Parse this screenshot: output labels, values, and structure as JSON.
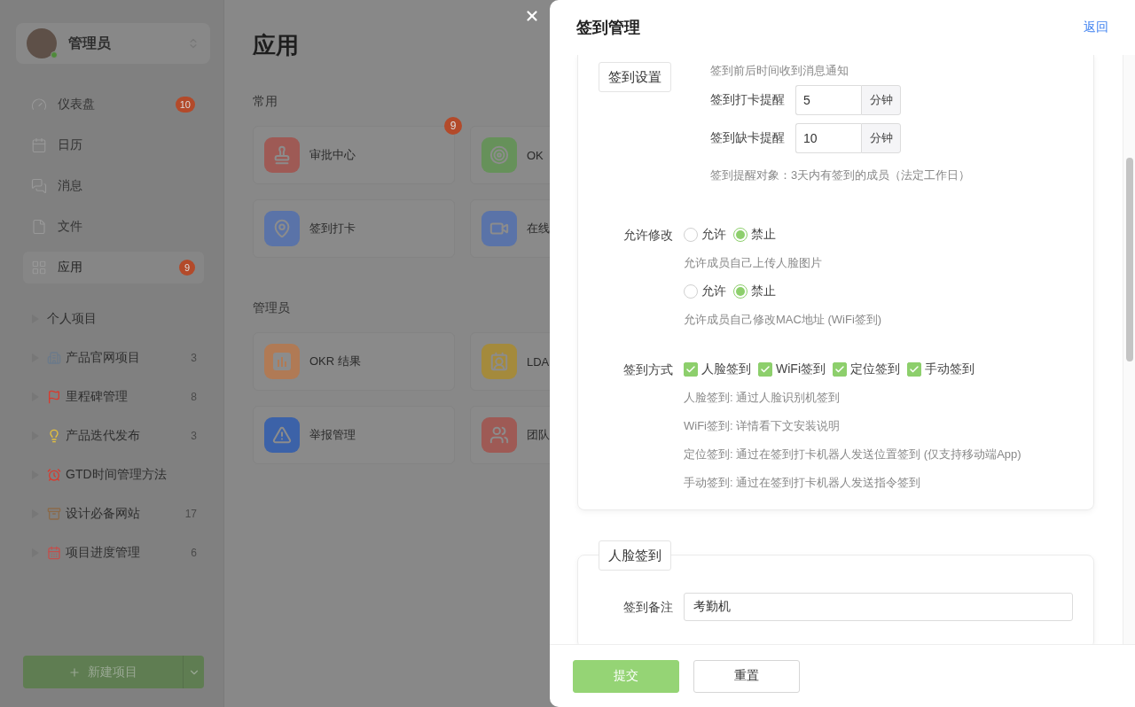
{
  "sidebar": {
    "user": {
      "name": "管理员",
      "online": true
    },
    "nav": [
      {
        "label": "仪表盘",
        "badge": "10",
        "selected": false
      },
      {
        "label": "日历",
        "selected": false
      },
      {
        "label": "消息",
        "selected": false
      },
      {
        "label": "文件",
        "selected": false
      },
      {
        "label": "应用",
        "badge": "9",
        "selected": true
      }
    ],
    "projects": [
      {
        "label": "个人项目"
      },
      {
        "label": "产品官网项目",
        "count": "3"
      },
      {
        "label": "里程碑管理",
        "count": "8"
      },
      {
        "label": "产品迭代发布",
        "count": "3"
      },
      {
        "label": "GTD时间管理方法"
      },
      {
        "label": "设计必备网站",
        "count": "17"
      },
      {
        "label": "项目进度管理",
        "count": "6"
      }
    ],
    "new_project_button": "新建项目"
  },
  "main": {
    "title": "应用",
    "sections": [
      {
        "title": "常用",
        "apps": [
          {
            "label": "审批中心",
            "color": "#9e5a55",
            "badge": "9"
          },
          {
            "label": "OK",
            "color": "#66915a"
          },
          {
            "label": "签到打卡",
            "color": "#5a73a8"
          },
          {
            "label": "在线",
            "color": "#5a73a8"
          }
        ]
      },
      {
        "title": "管理员",
        "apps": [
          {
            "label": "OKR 结果",
            "color": "#b07a55"
          },
          {
            "label": "LDA",
            "color": "#a48a3c"
          },
          {
            "label": "举报管理",
            "color": "#3c62a8"
          },
          {
            "label": "团队",
            "color": "#9e5a55"
          }
        ]
      }
    ]
  },
  "drawer": {
    "title": "签到管理",
    "back_link": "返回",
    "settings": {
      "legend": "签到设置",
      "note": "签到前后时间收到消息通知",
      "reminders": [
        {
          "label": "签到打卡提醒",
          "value": "5",
          "unit": "分钟"
        },
        {
          "label": "签到缺卡提醒",
          "value": "10",
          "unit": "分钟"
        }
      ],
      "target_note": "签到提醒对象：3天内有签到的成员（法定工作日）",
      "permission": {
        "label": "允许修改",
        "groups": [
          {
            "options": [
              {
                "label": "允许",
                "selected": false
              },
              {
                "label": "禁止",
                "selected": true
              }
            ],
            "hint": "允许成员自己上传人脸图片"
          },
          {
            "options": [
              {
                "label": "允许",
                "selected": false
              },
              {
                "label": "禁止",
                "selected": true
              }
            ],
            "hint": "允许成员自己修改MAC地址 (WiFi签到)"
          }
        ]
      },
      "methods": {
        "label": "签到方式",
        "options": [
          {
            "label": "人脸签到",
            "checked": true
          },
          {
            "label": "WiFi签到",
            "checked": true
          },
          {
            "label": "定位签到",
            "checked": true
          },
          {
            "label": "手动签到",
            "checked": true
          }
        ],
        "hints": [
          "人脸签到: 通过人脸识别机签到",
          "WiFi签到: 详情看下文安装说明",
          "定位签到: 通过在签到打卡机器人发送位置签到 (仅支持移动端App)",
          "手动签到: 通过在签到打卡机器人发送指令签到"
        ]
      }
    },
    "face": {
      "legend": "人脸签到",
      "fields": [
        {
          "label": "签到备注",
          "value": "考勤机"
        }
      ]
    },
    "buttons": [
      {
        "label": "提交",
        "kind": "primary"
      },
      {
        "label": "重置",
        "kind": "default"
      }
    ]
  }
}
